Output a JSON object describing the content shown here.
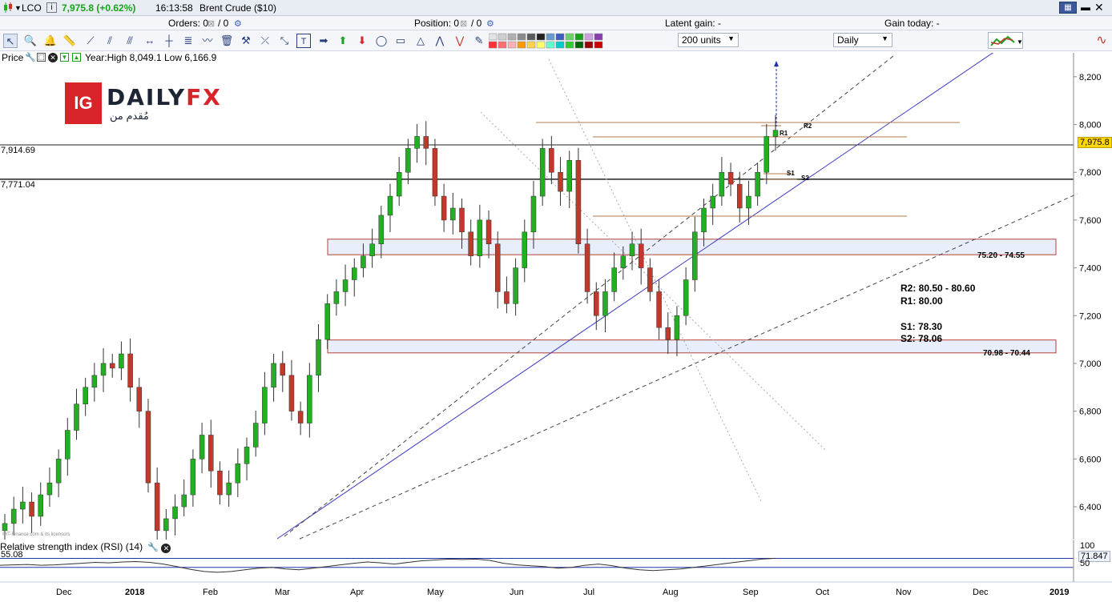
{
  "header": {
    "symbol": "LCO",
    "price_change": "7,975.8 (+0.62%)",
    "time": "16:13:58",
    "instrument": "Brent Crude ($10)"
  },
  "status": {
    "orders_label": "Orders: 0",
    "orders_rest": "/ 0",
    "position_label": "Position: 0",
    "position_rest": "/ 0",
    "latent_gain": "Latent gain: -",
    "gain_today": "Gain today: -"
  },
  "toolbar": {
    "units_value": "200 units",
    "timeframe_value": "Daily"
  },
  "price_header": {
    "label": "Price",
    "range": "Year:High 8,049.1 Low 6,166.9"
  },
  "logo": {
    "mark": "IG",
    "brand": "DAILY",
    "brand_accent": "FX",
    "tagline": "مُقدم من"
  },
  "levels": {
    "line1": "7,914.69",
    "line2": "7,771.04",
    "current": "7,975.8",
    "zone_upper": "75.20 - 74.55",
    "zone_lower": "70.98 - 70.44",
    "r1": "R1",
    "r2": "R2",
    "s1": "S1",
    "s2": "S2"
  },
  "notes": {
    "r2": "R2: 80.50 - 80.60",
    "r1": "R1: 80.00",
    "s1": "S1: 78.30",
    "s2": "S2: 78.06"
  },
  "rsi": {
    "label": "Relative strength index (RSI) (14)",
    "left_value": "55.08",
    "right_value": "71.847",
    "level_100": "100",
    "level_50": "50"
  },
  "watermark": "©IT-Finance.com & its licensors",
  "colors": {
    "bull": "#22b022",
    "bear": "#c0392b",
    "trend": "#3b3bc4",
    "zone": "#e8eefc",
    "zone_border": "#b0433a"
  },
  "chart_data": {
    "type": "candlestick",
    "title": "Brent Crude ($10)",
    "timeframe": "Daily",
    "y_ticks": [
      6400,
      6600,
      6800,
      7000,
      7200,
      7400,
      7600,
      7800,
      8000,
      8200
    ],
    "ylim": [
      6266,
      8300
    ],
    "x_labels": [
      "Dec",
      "2018",
      "Feb",
      "Mar",
      "Apr",
      "May",
      "Jun",
      "Jul",
      "Aug",
      "Sep",
      "Oct",
      "Nov",
      "Dec",
      "2019"
    ],
    "horizontal_lines": [
      7914.69,
      7771.04
    ],
    "zones": [
      {
        "label": "75.20 - 74.55",
        "high": 7520,
        "low": 7455
      },
      {
        "label": "70.98 - 70.44",
        "high": 7098,
        "low": 7044
      }
    ],
    "last_price": 7975.8,
    "closes": [
      6330,
      6390,
      6420,
      6360,
      6450,
      6500,
      6600,
      6720,
      6830,
      6900,
      6950,
      7000,
      6980,
      7040,
      6900,
      6800,
      6500,
      6300,
      6350,
      6400,
      6450,
      6600,
      6700,
      6550,
      6450,
      6500,
      6580,
      6650,
      6750,
      6900,
      7000,
      6950,
      6800,
      6750,
      6950,
      7100,
      7250,
      7300,
      7350,
      7400,
      7450,
      7500,
      7620,
      7700,
      7800,
      7900,
      7950,
      7900,
      7700,
      7600,
      7650,
      7550,
      7450,
      7600,
      7500,
      7300,
      7250,
      7400,
      7550,
      7700,
      7900,
      7800,
      7720,
      7850,
      7500,
      7300,
      7200,
      7300,
      7400,
      7450,
      7500,
      7400,
      7300,
      7150,
      7100,
      7200,
      7350,
      7550,
      7650,
      7700,
      7800,
      7750,
      7650,
      7700,
      7800,
      7950,
      7976
    ],
    "rsi_values": [
      55,
      56,
      57,
      55,
      56,
      58,
      60,
      62,
      61,
      63,
      64,
      62,
      58,
      52,
      45,
      40,
      38,
      40,
      44,
      48,
      50,
      46,
      44,
      48,
      52,
      56,
      60,
      63,
      61,
      58,
      62,
      66,
      68,
      70,
      69,
      70,
      67,
      60,
      56,
      54,
      52,
      48,
      50,
      55,
      58,
      54,
      48,
      44,
      42,
      44,
      46,
      50,
      54,
      58,
      62,
      66,
      70,
      72
    ],
    "rsi_levels": [
      100,
      71.847,
      50
    ]
  }
}
